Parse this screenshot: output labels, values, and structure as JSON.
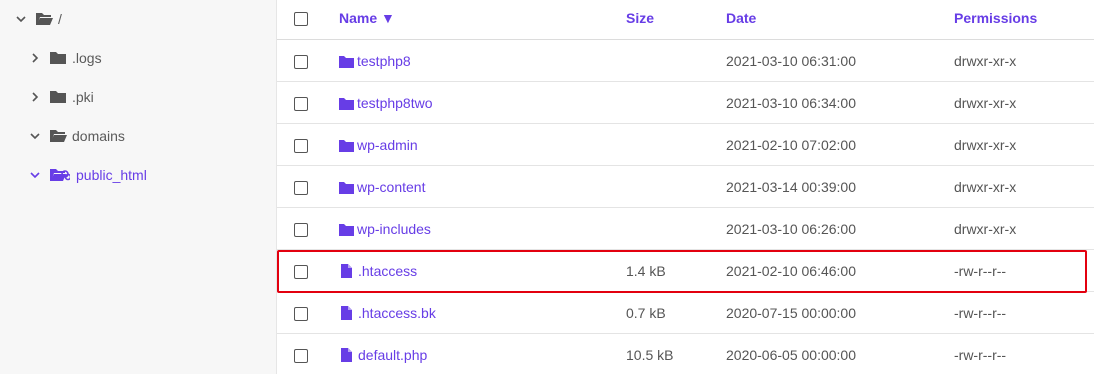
{
  "sidebar": {
    "root": {
      "label": "/"
    },
    "items": [
      {
        "label": ".logs"
      },
      {
        "label": ".pki"
      },
      {
        "label": "domains"
      },
      {
        "label": "public_html"
      }
    ]
  },
  "table": {
    "headers": {
      "name": "Name ▼",
      "size": "Size",
      "date": "Date",
      "permissions": "Permissions"
    },
    "rows": [
      {
        "type": "folder",
        "name": "testphp8",
        "size": "",
        "date": "2021-03-10 06:31:00",
        "permissions": "drwxr-xr-x"
      },
      {
        "type": "folder",
        "name": "testphp8two",
        "size": "",
        "date": "2021-03-10 06:34:00",
        "permissions": "drwxr-xr-x"
      },
      {
        "type": "folder",
        "name": "wp-admin",
        "size": "",
        "date": "2021-02-10 07:02:00",
        "permissions": "drwxr-xr-x"
      },
      {
        "type": "folder",
        "name": "wp-content",
        "size": "",
        "date": "2021-03-14 00:39:00",
        "permissions": "drwxr-xr-x"
      },
      {
        "type": "folder",
        "name": "wp-includes",
        "size": "",
        "date": "2021-03-10 06:26:00",
        "permissions": "drwxr-xr-x"
      },
      {
        "type": "file",
        "name": ".htaccess",
        "size": "1.4 kB",
        "date": "2021-02-10 06:46:00",
        "permissions": "-rw-r--r--"
      },
      {
        "type": "file",
        "name": ".htaccess.bk",
        "size": "0.7 kB",
        "date": "2020-07-15 00:00:00",
        "permissions": "-rw-r--r--"
      },
      {
        "type": "file",
        "name": "default.php",
        "size": "10.5 kB",
        "date": "2020-06-05 00:00:00",
        "permissions": "-rw-r--r--"
      }
    ]
  },
  "colors": {
    "accent": "#673de6",
    "highlight": "#e3000f",
    "text": "#555555"
  }
}
